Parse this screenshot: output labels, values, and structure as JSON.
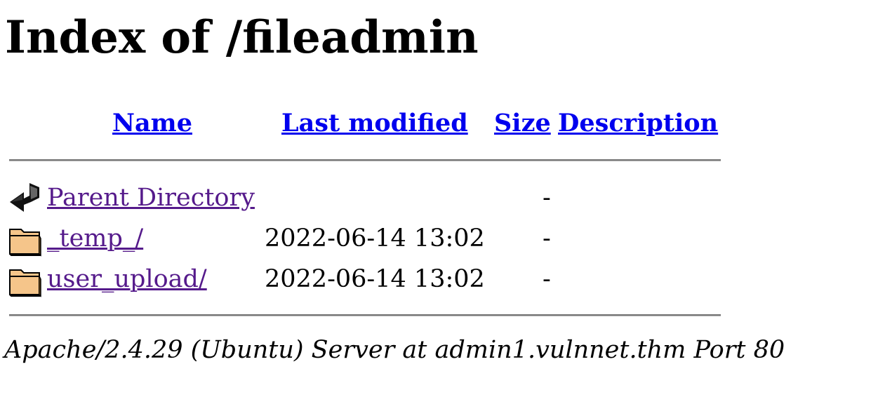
{
  "page": {
    "title": "Index of /fileadmin"
  },
  "table": {
    "headers": {
      "name": "Name",
      "last_modified": "Last modified",
      "size": "Size",
      "description": "Description"
    },
    "rows": [
      {
        "icon": "back-arrow-icon",
        "name": "Parent Directory",
        "last_modified": "",
        "size": "-"
      },
      {
        "icon": "folder-icon",
        "name": "_temp_/",
        "last_modified": "2022-06-14 13:02",
        "size": "-"
      },
      {
        "icon": "folder-icon",
        "name": "user_upload/",
        "last_modified": "2022-06-14 13:02",
        "size": "-"
      }
    ]
  },
  "footer": {
    "address": "Apache/2.4.29 (Ubuntu) Server at admin1.vulnnet.thm Port 80"
  },
  "colors": {
    "link": "#0000ee",
    "visited_link": "#551a8b",
    "rule": "#767676",
    "folder_fill": "#f5c58a"
  }
}
